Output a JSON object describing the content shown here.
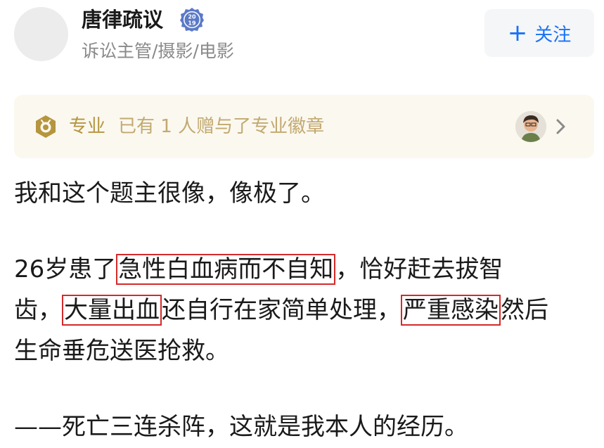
{
  "author": {
    "name": "唐律疏议",
    "badge_text": "2019",
    "bio": "诉讼主管/摄影/电影"
  },
  "follow_button": {
    "plus": "+",
    "label": "关注",
    "color": "#1772f6"
  },
  "pro_bar": {
    "icon": "professional-badge-icon",
    "label": "专业",
    "description": "已有 1 人赠与了专业徽章",
    "accent": "#b5953e"
  },
  "content": {
    "line1": "我和这个题主很像，像极了。",
    "p2_l1_pre": "26岁患了",
    "p2_l1_hl": "急性白血病而不自知",
    "p2_l1_post": "，恰好赶去拔智",
    "p2_l2_pre": "齿，",
    "p2_l2_hl1": "大量出血",
    "p2_l2_mid": "还自行在家简单处理，",
    "p2_l2_hl2": "严重感染",
    "p2_l2_post": "然后",
    "p2_l3": "生命垂危送医抢救。",
    "line4": "——死亡三连杀阵，这就是我本人的经历。",
    "highlight_color": "#d42a2a"
  }
}
